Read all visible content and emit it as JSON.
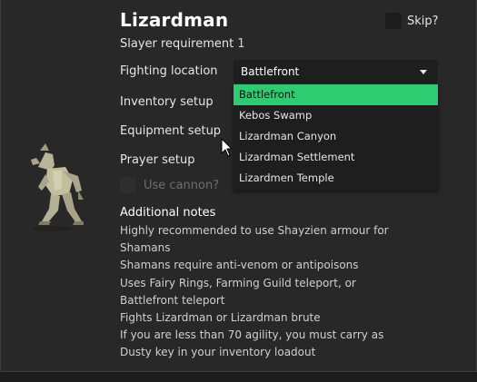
{
  "monster": {
    "name": "Lizardman",
    "image_icon": "lizardman-icon"
  },
  "skip": {
    "label": "Skip?",
    "checked": false
  },
  "slayer_requirement": {
    "label": "Slayer requirement",
    "value": "1"
  },
  "fighting_location": {
    "label": "Fighting location",
    "selected": "Battlefront",
    "options": [
      "Battlefront",
      "Kebos Swamp",
      "Lizardman Canyon",
      "Lizardman Settlement",
      "Lizardmen Temple"
    ]
  },
  "setup": {
    "inventory_label": "Inventory setup",
    "equipment_label": "Equipment setup",
    "prayer_label": "Prayer setup"
  },
  "cannon": {
    "label": "Use cannon?",
    "checked": false,
    "disabled": true
  },
  "notes": {
    "heading": "Additional notes",
    "lines": [
      "Highly recommended to use Shayzien armour for",
      "Shamans",
      "Shamans require anti-venom or antipoisons",
      "Uses Fairy Rings, Farming Guild teleport, or",
      "Battlefront teleport",
      "Fights Lizardman or Lizardman brute",
      "If you are less than 70 agility, you must carry as",
      "Dusty key in your inventory loadout"
    ]
  },
  "colors": {
    "background": "#282828",
    "selected_option": "#2ecc71",
    "dropdown_bg": "#1e1e1e",
    "disabled_text": "#6f6f6f"
  }
}
